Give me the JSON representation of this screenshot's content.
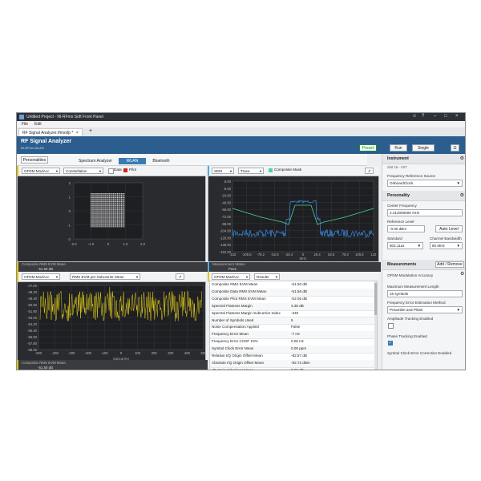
{
  "window": {
    "title": "Untitled Project - NI-RFmx Soft Front Panel"
  },
  "menu": {
    "file": "File",
    "edit": "Edit"
  },
  "doc_tab": {
    "label": "RF Signal Analyzer.rfmxsfp *",
    "close": "×",
    "add": "+"
  },
  "header": {
    "title": "RF Signal Analyzer",
    "subtitle": "NI-RFmx WLAN",
    "preset": "Preset",
    "run": "Run",
    "single": "Single"
  },
  "personalities_button": "Personalities",
  "personality_tabs": [
    "Spectrum Analyzer",
    "WLAN",
    "Bluetooth"
  ],
  "personality_tab_active": 1,
  "constellation_pane": {
    "measurement": "OFDM ModAcc",
    "view": "Constellation",
    "legend_data": "Data",
    "legend_pilot": "Pilot",
    "yticks": [
      "2",
      "1",
      "0",
      "-1",
      "-2"
    ],
    "xticks": [
      "-2.0",
      "-1.0",
      "0",
      "1.0",
      "2.0"
    ],
    "footer_label": "Composite RMS EVM Mean",
    "footer_value": "-51.50 dB"
  },
  "sem_pane": {
    "measurement": "SEM",
    "view": "Trace",
    "legend": "Composite Mask",
    "yticks": [
      "8.00",
      "-8.00",
      "-24.00",
      "-40.00",
      "-56.00",
      "-72.00",
      "-88.00",
      "-104.00",
      "-120.00",
      "-136.00",
      "-152.00"
    ],
    "xticks": [
      "-132",
      "-105.6",
      "-79.2",
      "-52.8",
      "-26.4",
      "0",
      "26.4",
      "52.8",
      "79.2",
      "105.6",
      "132"
    ],
    "xunit": "MHz",
    "footer_label": "Measurement Status",
    "footer_value": "Pass"
  },
  "evm_pane": {
    "measurement": "OFDM ModAcc",
    "view": "RMS EVM per Subcarrier Mean",
    "yticks": [
      "-47.00",
      "-48.20",
      "-49.40",
      "-50.60",
      "-51.80",
      "-53.00",
      "-54.20",
      "-55.40",
      "-56.60",
      "-57.80",
      "-59.00"
    ],
    "xticks": [
      "-500",
      "-400",
      "-300",
      "-200",
      "-100",
      "0",
      "100",
      "200",
      "300",
      "400",
      "500"
    ],
    "xlabel": "Subcarrier",
    "footer_label": "Composite RMS EVM Mean",
    "footer_value": "-51.50 dB"
  },
  "results_pane": {
    "measurement": "OFDM ModAcc",
    "view": "Results",
    "rows": [
      {
        "name": "Composite RMS EVM Mean",
        "value": "-51.50 dB"
      },
      {
        "name": "Composite Data RMS EVM Mean",
        "value": "-51.56 dB"
      },
      {
        "name": "Composite Pilot RMS EVM Mean",
        "value": "-52.05 dB"
      },
      {
        "name": "Spectral Flatness Margin",
        "value": "3.38 dB"
      },
      {
        "name": "Spectral Flatness Margin Subcarrier Index",
        "value": "-340"
      },
      {
        "name": "Number of Symbols Used",
        "value": "5"
      },
      {
        "name": "Noise Compensation Applied",
        "value": "False"
      },
      {
        "name": "Frequency Error Mean",
        "value": "-7 Hz"
      },
      {
        "name": "Frequency Error CCDF 10%",
        "value": "0.00 Hz"
      },
      {
        "name": "Symbol Clock Error Mean",
        "value": "0.00 ppm"
      },
      {
        "name": "Relative I/Q Origin Offset Mean",
        "value": "-82.57 dB"
      },
      {
        "name": "Absolute I/Q Origin Offset Mean",
        "value": "-92.72 dBm"
      },
      {
        "name": "I/Q Gain Imbalance Mean",
        "value": "0.00 dB"
      }
    ]
  },
  "right_panel": {
    "instrument": {
      "title": "Instrument",
      "slot": "Slot 16 - VST",
      "freq_ref_label": "Frequency Reference Source",
      "freq_ref_value": "OnboardClock"
    },
    "personality": {
      "title": "Personality",
      "center_freq_label": "Center Frequency",
      "center_freq_value": "2.412000000 GHz",
      "ref_level_label": "Reference Level",
      "ref_level_value": "-0.00 dBm",
      "auto_level": "Auto Level",
      "standard_label": "Standard",
      "standard_value": "802.11ax",
      "cbw_label": "Channel Bandwidth",
      "cbw_value": "80 MHz"
    },
    "measurements": {
      "title": "Measurements",
      "add_remove": "Add / Remove",
      "item": "OFDM Modulation Accuracy",
      "max_len_label": "Maximum Measurement Length",
      "max_len_value": "16 symbols",
      "fe_method_label": "Frequency Error Estimation Method",
      "fe_method_value": "Preamble and Pilots",
      "amp_track_label": "Amplitude Tracking Enabled",
      "phase_track_label": "Phase Tracking Enabled",
      "symclk_label": "Symbol Clock Error Correction Enabled",
      "amp_track_checked": false,
      "phase_track_checked": true
    }
  },
  "colors": {
    "header_blue": "#2b5d8e",
    "trace_blue": "#3d9bff",
    "mask_green": "#4fd1a0",
    "trace_yellow": "#e6d21a",
    "pilot_red": "#d62020"
  }
}
